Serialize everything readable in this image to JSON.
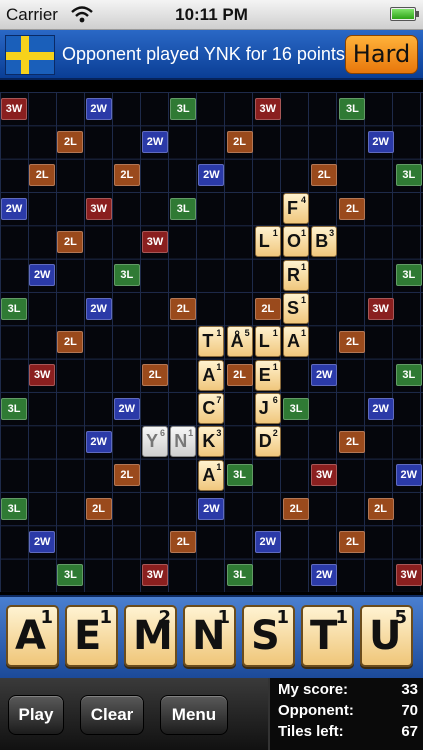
{
  "status_bar": {
    "carrier": "Carrier",
    "time": "10:11 PM",
    "icons": [
      "wifi-icon",
      "battery-icon"
    ]
  },
  "header": {
    "flag": "sweden-flag",
    "message": "Opponent played YNK for 16 points",
    "difficulty": "Hard"
  },
  "board": {
    "rows": 15,
    "cols": 15,
    "premium_colors": {
      "3W": "#8a1f1f",
      "2W": "#2b3aa8",
      "3L": "#2f7a34",
      "2L": "#9a4a1c"
    },
    "premium_squares": [
      {
        "label": "3W",
        "row": 0,
        "col": 0
      },
      {
        "label": "2W",
        "row": 0,
        "col": 3
      },
      {
        "label": "3L",
        "row": 0,
        "col": 6
      },
      {
        "label": "3W",
        "row": 0,
        "col": 9
      },
      {
        "label": "3L",
        "row": 0,
        "col": 12
      },
      {
        "label": "2L",
        "row": 1,
        "col": 2
      },
      {
        "label": "2W",
        "row": 1,
        "col": 5
      },
      {
        "label": "2L",
        "row": 1,
        "col": 8
      },
      {
        "label": "2W",
        "row": 1,
        "col": 13
      },
      {
        "label": "2L",
        "row": 2,
        "col": 1
      },
      {
        "label": "2L",
        "row": 2,
        "col": 4
      },
      {
        "label": "2W",
        "row": 2,
        "col": 7
      },
      {
        "label": "2L",
        "row": 2,
        "col": 11
      },
      {
        "label": "3L",
        "row": 2,
        "col": 14
      },
      {
        "label": "2W",
        "row": 3,
        "col": 0
      },
      {
        "label": "3W",
        "row": 3,
        "col": 3
      },
      {
        "label": "3L",
        "row": 3,
        "col": 6
      },
      {
        "label": "2L",
        "row": 3,
        "col": 12
      },
      {
        "label": "2L",
        "row": 4,
        "col": 2
      },
      {
        "label": "3W",
        "row": 4,
        "col": 5
      },
      {
        "label": "2W",
        "row": 5,
        "col": 1
      },
      {
        "label": "3L",
        "row": 5,
        "col": 4
      },
      {
        "label": "3L",
        "row": 5,
        "col": 14
      },
      {
        "label": "3L",
        "row": 6,
        "col": 0
      },
      {
        "label": "2W",
        "row": 6,
        "col": 3
      },
      {
        "label": "2L",
        "row": 6,
        "col": 6
      },
      {
        "label": "2L",
        "row": 6,
        "col": 9
      },
      {
        "label": "3W",
        "row": 6,
        "col": 13
      },
      {
        "label": "2L",
        "row": 7,
        "col": 2
      },
      {
        "label": "2L",
        "row": 7,
        "col": 12
      },
      {
        "label": "3W",
        "row": 8,
        "col": 1
      },
      {
        "label": "2L",
        "row": 8,
        "col": 5
      },
      {
        "label": "2L",
        "row": 8,
        "col": 8
      },
      {
        "label": "2W",
        "row": 8,
        "col": 11
      },
      {
        "label": "3L",
        "row": 8,
        "col": 14
      },
      {
        "label": "3L",
        "row": 9,
        "col": 0
      },
      {
        "label": "2W",
        "row": 9,
        "col": 4
      },
      {
        "label": "3L",
        "row": 9,
        "col": 10
      },
      {
        "label": "2W",
        "row": 9,
        "col": 13
      },
      {
        "label": "2W",
        "row": 10,
        "col": 3
      },
      {
        "label": "2L",
        "row": 10,
        "col": 12
      },
      {
        "label": "2L",
        "row": 11,
        "col": 4
      },
      {
        "label": "3L",
        "row": 11,
        "col": 8
      },
      {
        "label": "3W",
        "row": 11,
        "col": 11
      },
      {
        "label": "2W",
        "row": 11,
        "col": 14
      },
      {
        "label": "3L",
        "row": 12,
        "col": 0
      },
      {
        "label": "2L",
        "row": 12,
        "col": 3
      },
      {
        "label": "2W",
        "row": 12,
        "col": 7
      },
      {
        "label": "2L",
        "row": 12,
        "col": 10
      },
      {
        "label": "2L",
        "row": 12,
        "col": 13
      },
      {
        "label": "2W",
        "row": 13,
        "col": 1
      },
      {
        "label": "2L",
        "row": 13,
        "col": 6
      },
      {
        "label": "2W",
        "row": 13,
        "col": 9
      },
      {
        "label": "2L",
        "row": 13,
        "col": 12
      },
      {
        "label": "3L",
        "row": 14,
        "col": 2
      },
      {
        "label": "3W",
        "row": 14,
        "col": 5
      },
      {
        "label": "3L",
        "row": 14,
        "col": 8
      },
      {
        "label": "2W",
        "row": 14,
        "col": 11
      },
      {
        "label": "3W",
        "row": 14,
        "col": 14
      }
    ],
    "tiles": [
      {
        "letter": "F",
        "points": 4,
        "row": 3,
        "col": 10
      },
      {
        "letter": "L",
        "points": 1,
        "row": 4,
        "col": 9
      },
      {
        "letter": "O",
        "points": 1,
        "row": 4,
        "col": 10
      },
      {
        "letter": "B",
        "points": 3,
        "row": 4,
        "col": 11
      },
      {
        "letter": "R",
        "points": 1,
        "row": 5,
        "col": 10
      },
      {
        "letter": "S",
        "points": 1,
        "row": 6,
        "col": 10
      },
      {
        "letter": "T",
        "points": 1,
        "row": 7,
        "col": 7
      },
      {
        "letter": "Å",
        "points": 5,
        "row": 7,
        "col": 8
      },
      {
        "letter": "L",
        "points": 1,
        "row": 7,
        "col": 9
      },
      {
        "letter": "A",
        "points": 1,
        "row": 7,
        "col": 10
      },
      {
        "letter": "A",
        "points": 1,
        "row": 8,
        "col": 7
      },
      {
        "letter": "E",
        "points": 1,
        "row": 8,
        "col": 9
      },
      {
        "letter": "C",
        "points": 7,
        "row": 9,
        "col": 7
      },
      {
        "letter": "J",
        "points": 6,
        "row": 9,
        "col": 9
      },
      {
        "letter": "K",
        "points": 3,
        "row": 10,
        "col": 7
      },
      {
        "letter": "D",
        "points": 2,
        "row": 10,
        "col": 9
      },
      {
        "letter": "A",
        "points": 1,
        "row": 11,
        "col": 7
      }
    ],
    "last_move_tiles": [
      {
        "letter": "Y",
        "points": 6,
        "row": 10,
        "col": 5
      },
      {
        "letter": "N",
        "points": 1,
        "row": 10,
        "col": 6
      }
    ]
  },
  "rack": [
    {
      "letter": "A",
      "points": 1
    },
    {
      "letter": "E",
      "points": 1
    },
    {
      "letter": "M",
      "points": 2
    },
    {
      "letter": "N",
      "points": 1
    },
    {
      "letter": "S",
      "points": 1
    },
    {
      "letter": "T",
      "points": 1
    },
    {
      "letter": "U",
      "points": 5
    }
  ],
  "buttons": {
    "play": "Play",
    "clear": "Clear",
    "menu": "Menu"
  },
  "scores": {
    "my_score_label": "My score:",
    "my_score": "33",
    "opponent_label": "Opponent:",
    "opponent": "70",
    "tiles_left_label": "Tiles left:",
    "tiles_left": "67"
  }
}
